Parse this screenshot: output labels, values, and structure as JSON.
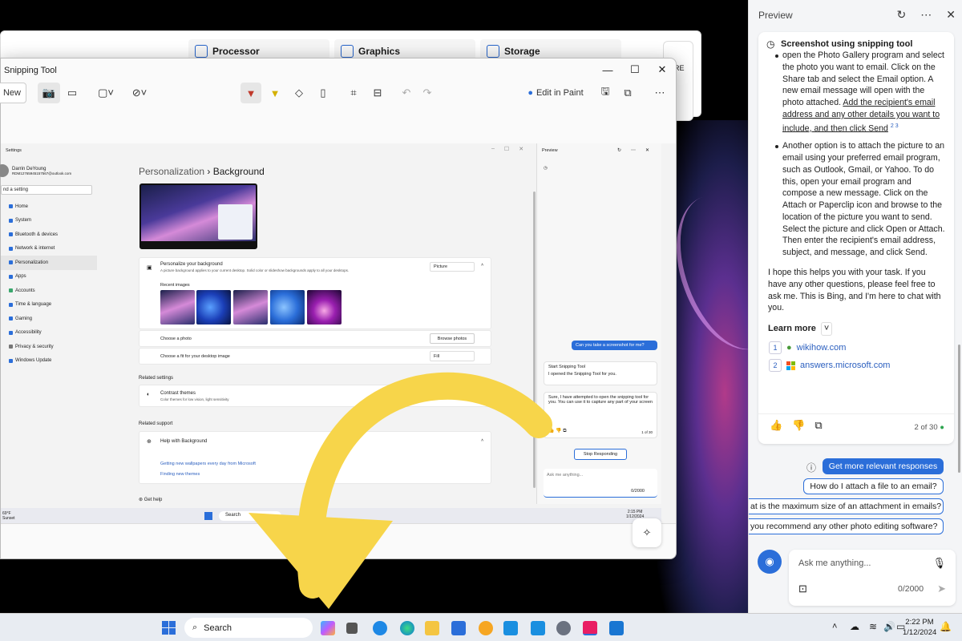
{
  "hardware_cards": [
    "Processor",
    "Graphics",
    "Storage"
  ],
  "ore_label": "ORE",
  "snip": {
    "title": "Snipping Tool",
    "new_label": "New",
    "edit_in_paint": "Edit in Paint",
    "icons": [
      "camera-icon",
      "video-icon",
      "rectangle-mode-icon",
      "delay-icon",
      "pen-icon",
      "highlighter-icon",
      "eraser-icon",
      "ruler-icon",
      "crop-icon",
      "text-actions-icon",
      "undo-icon",
      "redo-icon",
      "save-icon",
      "copy-icon",
      "more-icon"
    ]
  },
  "inner_settings": {
    "window_title": "Settings",
    "user_name": "Darrin DeYoung",
    "user_email": "RDM12765945157567@outlook.com",
    "search_placeholder": "nd a setting",
    "nav": [
      "Home",
      "System",
      "Bluetooth & devices",
      "Network & internet",
      "Personalization",
      "Apps",
      "Accounts",
      "Time & language",
      "Gaming",
      "Accessibility",
      "Privacy & security",
      "Windows Update"
    ],
    "breadcrumb_parent": "Personalization",
    "breadcrumb_sep": "›",
    "breadcrumb_current": "Background",
    "personalize_title": "Personalize your background",
    "personalize_desc": "A picture background applies to your current desktop. Solid color or slideshow backgrounds apply to all your desktops.",
    "personalize_value": "Picture",
    "recent_images": "Recent images",
    "choose_photo": "Choose a photo",
    "browse_photos": "Browse photos",
    "choose_fit": "Choose a fit for your desktop image",
    "fit_value": "Fill",
    "related_settings": "Related settings",
    "contrast_title": "Contrast themes",
    "contrast_desc": "Color themes for low vision, light sensitivity",
    "related_support": "Related support",
    "help_background": "Help with Background",
    "link1": "Getting new wallpapers every day from Microsoft",
    "link2": "Finding new themes",
    "get_help": "Get help",
    "weather_temp": "69°F",
    "weather_desc": "Sunset",
    "taskbar_search": "Search",
    "time": "2:15 PM",
    "date": "1/12/2024"
  },
  "inner_copilot": {
    "title": "Preview",
    "user_msg": "Can you take a screenshot for me?",
    "task_title": "Start Snipping Tool",
    "task_body": "I opened the Snipping Tool for you.",
    "reply": "Sure, I have attempted to open the snipping tool for you. You can use it to capture any part of your screen",
    "counter": "1 of 30",
    "stop": "Stop Responding",
    "ask_placeholder": "Ask me anything...",
    "char_count": "0/2000"
  },
  "copilot": {
    "title": "Preview",
    "response_title": "Screenshot using snipping tool",
    "bullet1_start": "open the Photo Gallery program and select the photo you want to email. Click on the Share tab and select the Email option. A new email message will open with the photo attached. ",
    "bullet1_link": "Add the recipient's email address and any other details you want to include, and then click Send",
    "bullet1_refs": "2  3",
    "bullet2": "Another option is to attach the picture to an email using your preferred email program, such as Outlook, Gmail, or Yahoo. To do this, open your email program and compose a new message. Click on the Attach or Paperclip icon and browse to the location of the picture you want to send. Select the picture and click Open or Attach. Then enter the recipient's email address, subject, and message, and click Send.",
    "closing": "I hope this helps you with your task. If you have any other questions, please feel free to ask me. This is Bing, and I'm here to chat with you.",
    "learn_more": "Learn more",
    "citations": [
      {
        "n": "1",
        "site": "wikihow.com"
      },
      {
        "n": "2",
        "site": "answers.microsoft.com"
      }
    ],
    "counter": "2 of 30",
    "get_more": "Get more relevant responses",
    "suggestions": [
      "How do I attach a file to an email?",
      "at is the maximum size of an attachment in emails?",
      "you recommend any other photo editing software?"
    ],
    "ask_placeholder": "Ask me anything...",
    "char_count": "0/2000"
  },
  "taskbar": {
    "search_label": "Search",
    "time": "2:22 PM",
    "date": "1/12/2024"
  },
  "colors": {
    "accent": "#2b6ed9",
    "arrow": "#f7d54a"
  }
}
